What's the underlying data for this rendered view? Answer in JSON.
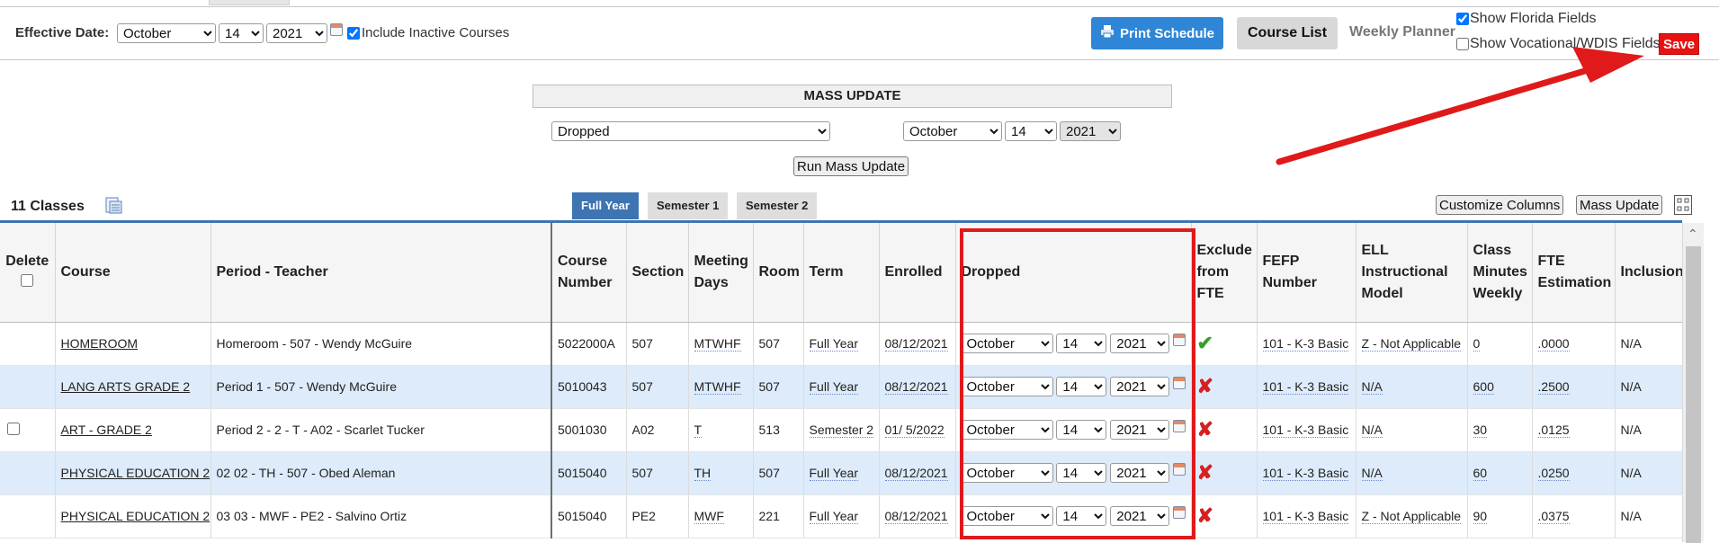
{
  "toolbar": {
    "effective_date_label": "Effective Date:",
    "date": {
      "month": "October",
      "day": "14",
      "year": "2021"
    },
    "include_inactive_label": "Include Inactive Courses",
    "include_inactive_checked": true,
    "print_schedule_label": "Print Schedule",
    "course_list_label": "Course List",
    "weekly_planner_label": "Weekly Planner",
    "show_florida_label": "Show Florida Fields",
    "show_florida_checked": true,
    "show_vocational_label": "Show Vocational/WDIS Fields",
    "show_vocational_checked": false,
    "save_label": "Save"
  },
  "mass_update": {
    "title": "MASS UPDATE",
    "field_value": "Dropped",
    "date": {
      "month": "October",
      "day": "14",
      "year": "2021"
    },
    "run_label": "Run Mass Update"
  },
  "classes_bar": {
    "count_label": "11 Classes",
    "tabs": [
      {
        "label": "Full Year",
        "active": true
      },
      {
        "label": "Semester 1",
        "active": false
      },
      {
        "label": "Semester 2",
        "active": false
      }
    ],
    "customize_columns_label": "Customize Columns",
    "mass_update_label": "Mass Update"
  },
  "table": {
    "headers": {
      "delete": "Delete",
      "course": "Course",
      "period_teacher": "Period - Teacher",
      "course_number": "Course Number",
      "section": "Section",
      "meeting_days": "Meeting Days",
      "room": "Room",
      "term": "Term",
      "enrolled": "Enrolled",
      "dropped": "Dropped",
      "exclude_fte": "Exclude from FTE",
      "fefp": "FEFP Number",
      "ell": "ELL Instructional Model",
      "class_minutes": "Class Minutes Weekly",
      "fte_estimation": "FTE Estimation",
      "inclusion": "Inclusion"
    },
    "rows": [
      {
        "course": "HOMEROOM",
        "period_teacher": "Homeroom - 507 - Wendy McGuire",
        "course_number": "5022000A",
        "section": "507",
        "meeting_days": "MTWHF",
        "room": "507",
        "term": "Full Year",
        "enrolled": "08/12/2021",
        "dropped_month": "October",
        "dropped_day": "14",
        "dropped_year": "2021",
        "exclude_icon": "check-icon",
        "fefp": "101 - K-3 Basic",
        "ell": "Z - Not Applicable",
        "class_minutes": "0",
        "fte_estimation": ".0000",
        "inclusion": "N/A",
        "has_delete": false
      },
      {
        "course": "LANG ARTS GRADE 2",
        "period_teacher": "Period 1 - 507 - Wendy McGuire",
        "course_number": "5010043",
        "section": "507",
        "meeting_days": "MTWHF",
        "room": "507",
        "term": "Full Year",
        "enrolled": "08/12/2021",
        "dropped_month": "October",
        "dropped_day": "14",
        "dropped_year": "2021",
        "exclude_icon": "x-icon",
        "fefp": "101 - K-3 Basic",
        "ell": "N/A",
        "class_minutes": "600",
        "fte_estimation": ".2500",
        "inclusion": "N/A",
        "has_delete": false
      },
      {
        "course": "ART - GRADE 2",
        "period_teacher": "Period 2 - 2 - T - A02 - Scarlet Tucker",
        "course_number": "5001030",
        "section": "A02",
        "meeting_days": "T",
        "room": "513",
        "term": "Semester 2",
        "enrolled": "01/ 5/2022",
        "dropped_month": "October",
        "dropped_day": "14",
        "dropped_year": "2021",
        "exclude_icon": "x-icon",
        "fefp": "101 - K-3 Basic",
        "ell": "N/A",
        "class_minutes": "30",
        "fte_estimation": ".0125",
        "inclusion": "N/A",
        "has_delete": true
      },
      {
        "course": "PHYSICAL EDUCATION 2",
        "period_teacher": "02 02 - TH - 507 - Obed Aleman",
        "course_number": "5015040",
        "section": "507",
        "meeting_days": "TH",
        "room": "507",
        "term": "Full Year",
        "enrolled": "08/12/2021",
        "dropped_month": "October",
        "dropped_day": "14",
        "dropped_year": "2021",
        "exclude_icon": "x-icon",
        "fefp": "101 - K-3 Basic",
        "ell": "N/A",
        "class_minutes": "60",
        "fte_estimation": ".0250",
        "inclusion": "N/A",
        "has_delete": false
      },
      {
        "course": "PHYSICAL EDUCATION 2",
        "period_teacher": "03 03 - MWF - PE2 - Salvino Ortiz",
        "course_number": "5015040",
        "section": "PE2",
        "meeting_days": "MWF",
        "room": "221",
        "term": "Full Year",
        "enrolled": "08/12/2021",
        "dropped_month": "October",
        "dropped_day": "14",
        "dropped_year": "2021",
        "exclude_icon": "x-icon",
        "fefp": "101 - K-3 Basic",
        "ell": "Z - Not Applicable",
        "class_minutes": "90",
        "fte_estimation": ".0375",
        "inclusion": "N/A",
        "has_delete": false
      }
    ]
  },
  "annotation": {
    "color": "#e01a1a"
  }
}
